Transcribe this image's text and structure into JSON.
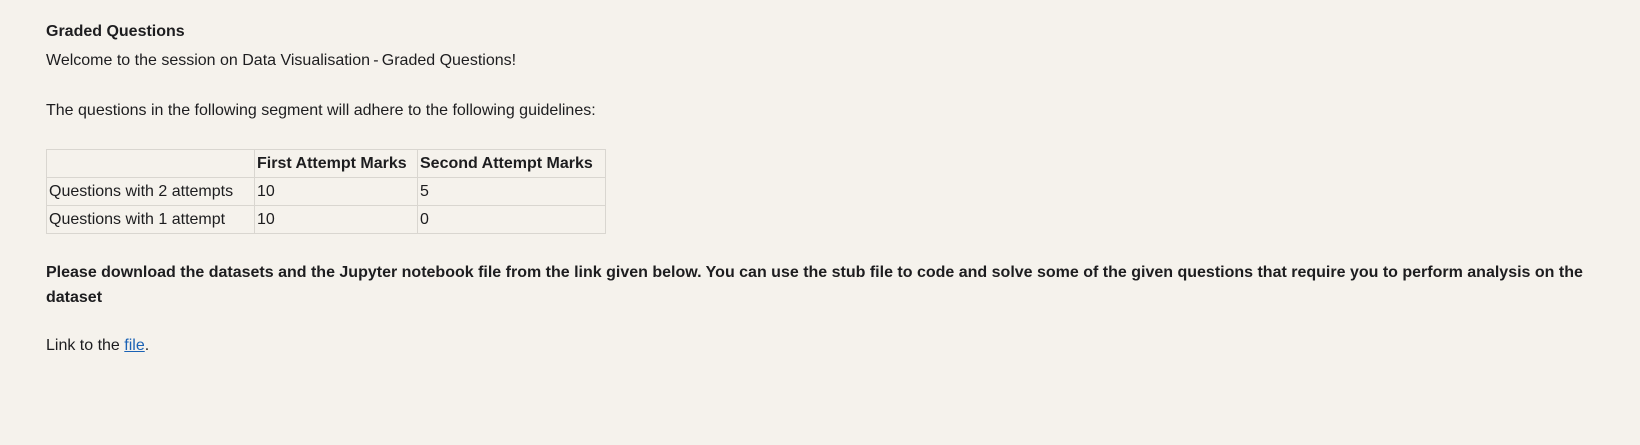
{
  "section": {
    "title": "Graded Questions",
    "welcome": "Welcome to the session on Data Visualisation - Graded Questions!",
    "guidelines_intro": "The questions in the following segment will adhere to the following guidelines:"
  },
  "table": {
    "headers": [
      "",
      "First Attempt Marks",
      "Second Attempt Marks"
    ],
    "rows": [
      [
        "Questions with 2 attempts",
        "10",
        "5"
      ],
      [
        "Questions with 1 attempt",
        "10",
        "0"
      ]
    ]
  },
  "download_note": "Please download the datasets and the Jupyter notebook file from the link given below. You can use the stub file to code and solve some of the given questions that require you to perform analysis on the dataset",
  "link_line": {
    "prefix": "Link to the ",
    "link_text": "file",
    "suffix": "."
  },
  "colors": {
    "background": "#f5f2ec",
    "text": "#1d1d1f",
    "link": "#1a62b5",
    "table_border": "#d9d6d0"
  }
}
